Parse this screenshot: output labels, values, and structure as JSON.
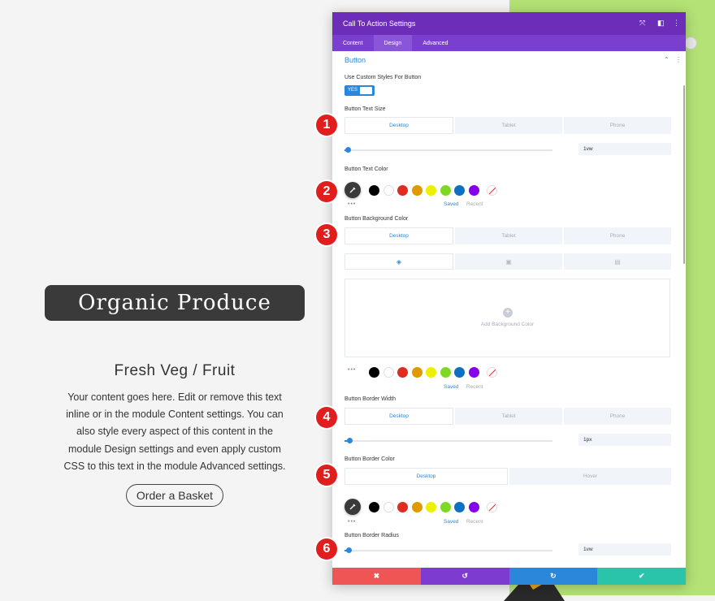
{
  "page": {
    "hero_title": "Organic Produce",
    "subtitle": "Fresh Veg / Fruit",
    "body": "Your content goes here. Edit or remove this text inline or in the module Content settings. You can also style every aspect of this content in the module Design settings and even apply custom CSS to this text in the module Advanced settings.",
    "cta": "Order a Basket"
  },
  "panel": {
    "title": "Call To Action Settings",
    "header_icons": {
      "expand": "⤧",
      "snap": "◧",
      "more": "⋮"
    },
    "tabs": [
      "Content",
      "Design",
      "Advanced"
    ],
    "active_tab": "Design",
    "section": {
      "title": "Button",
      "collapse_icon": "⌃",
      "more_icon": "⋮"
    }
  },
  "fields": {
    "custom_styles": {
      "label": "Use Custom Styles For Button",
      "toggle": "YES"
    },
    "text_size": {
      "label": "Button Text Size",
      "value": "1vw"
    },
    "text_color": {
      "label": "Button Text Color"
    },
    "bg_color": {
      "label": "Button Background Color",
      "add_label": "Add Background Color",
      "add_icon": "+"
    },
    "border_width": {
      "label": "Button Border Width",
      "value": "1px"
    },
    "border_color": {
      "label": "Button Border Color"
    },
    "border_radius": {
      "label": "Button Border Radius",
      "value": "1vw"
    }
  },
  "device_tabs": [
    "Desktop",
    "Tablet",
    "Phone"
  ],
  "state_tabs": [
    "Desktop",
    "Hover"
  ],
  "bg_tab_icons": [
    "◈",
    "▣",
    "▤"
  ],
  "saved_label": "Saved",
  "recent_label": "Recent",
  "more_dots": "•••",
  "swatches": [
    "#000000",
    "#ffffff",
    "#e02b20",
    "#e09900",
    "#edf000",
    "#7cda24",
    "#0c71c3",
    "#8300e9"
  ],
  "colors": {
    "accent": "#2b87da",
    "header": "#6c2eb9",
    "cancel": "#ef5555",
    "undo": "#7e3bd0",
    "redo": "#2b87da",
    "save": "#29c4a9",
    "marker": "#e01e1e"
  },
  "bottom_bar": {
    "cancel": "✖",
    "undo": "↺",
    "redo": "↻",
    "save": "✔"
  },
  "markers": [
    "1",
    "2",
    "3",
    "4",
    "5",
    "6"
  ]
}
